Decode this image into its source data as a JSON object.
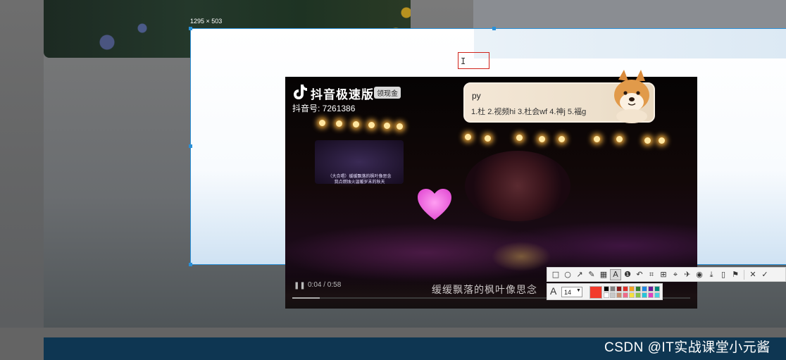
{
  "capture": {
    "dimensions_label": "1295 × 503"
  },
  "video": {
    "brand_name": "抖音极速版",
    "brand_badge": "领现金",
    "douyin_id": "抖音号: 7261386",
    "stage_lyrics": [
      "（大合唱）缓缓飘落的枫叶像思念",
      "我点燃烛火温暖岁末的秋天"
    ],
    "time_readout": "0:04 / 0:58",
    "subtitle": "缓缓飘落的枫叶像思念",
    "progress": 0.069
  },
  "ime": {
    "input_text": "py",
    "candidates": "1.杜  2.视频hi  3.杜会wf  4.神j  5.褔g"
  },
  "toolbar": {
    "tools": [
      {
        "name": "rectangle-tool-button",
        "icon": "□",
        "active": false
      },
      {
        "name": "ellipse-tool-button",
        "icon": "○",
        "active": false
      },
      {
        "name": "arrow-tool-button",
        "icon": "↗",
        "active": false
      },
      {
        "name": "pencil-tool-button",
        "icon": "✎",
        "active": false
      },
      {
        "name": "mosaic-tool-button",
        "icon": "▦",
        "active": false
      },
      {
        "name": "text-tool-button",
        "icon": "A",
        "active": true
      },
      {
        "name": "serial-number-tool-button",
        "icon": "❶",
        "active": false
      },
      {
        "name": "undo-button",
        "icon": "↶",
        "active": false
      },
      {
        "name": "ocr-button",
        "icon": "⌗",
        "active": false
      },
      {
        "name": "translate-button",
        "icon": "⊞",
        "active": false
      },
      {
        "name": "scan-button",
        "icon": "⌖",
        "active": false
      },
      {
        "name": "pin-button",
        "icon": "✈",
        "active": false
      },
      {
        "name": "record-button",
        "icon": "◉",
        "active": false
      },
      {
        "name": "save-button",
        "icon": "⤓",
        "active": false
      },
      {
        "name": "long-screenshot-button",
        "icon": "▯",
        "active": false
      },
      {
        "name": "collect-button",
        "icon": "⚑",
        "active": false
      },
      {
        "name": "close-button",
        "icon": "✕",
        "active": false
      },
      {
        "name": "done-button",
        "icon": "✓",
        "active": false
      }
    ],
    "font_size": "14",
    "current_color": "#f23a2b",
    "palette_top": [
      "#000000",
      "#7f7f7f",
      "#8b1a1a",
      "#e0302a",
      "#f0a020",
      "#2e7d32",
      "#1e88e5",
      "#6a1b9a",
      "#00897b"
    ],
    "palette_bottom": [
      "#ffffff",
      "#c8c8c8",
      "#c89070",
      "#f06a8a",
      "#f4e040",
      "#8bc34a",
      "#26c6da",
      "#e040c0",
      "#4dd0e1"
    ]
  },
  "watermark": {
    "text": "CSDN @IT实战课堂小元酱"
  }
}
